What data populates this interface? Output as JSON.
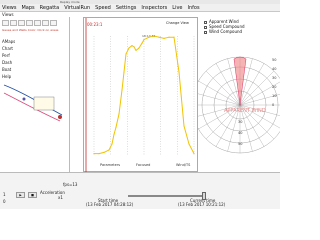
{
  "window": {
    "title": "Weather Routing Application",
    "subtitle": "Replay mode"
  },
  "menu": {
    "items": [
      "Views",
      "Maps",
      "Regatta",
      "VirtualRun",
      "Speed",
      "Settings",
      "Inspectors",
      "Live",
      "Infos"
    ]
  },
  "views_label": "Views",
  "left_panel": {
    "hint": "Issues and Wells Color: Click on areas",
    "items": [
      "AMaps",
      "Chart",
      "Perf",
      "Dash",
      "Boat",
      "Help"
    ]
  },
  "center_panel": {
    "top_label": "00:23:1",
    "top_value": "18:10.52",
    "legend": "Change View",
    "bottom_labels": {
      "left": "Parameters",
      "middle": "Focused",
      "right": "Wind/TS"
    },
    "fps_label": "fps=13"
  },
  "polar_panel": {
    "legend": [
      "Apparent Wind",
      "Speed Compound",
      "Wind Compound"
    ],
    "apparent_wind_label": "APPARENT WIND",
    "tick_labels_right": [
      "50",
      "40",
      "30",
      "20",
      "10",
      "0"
    ],
    "tick_labels_bottom": [
      "30",
      "40",
      "50"
    ]
  },
  "bottom_bar": {
    "acceleration_label": "Acceleration",
    "acceleration_value": "x1",
    "start_time_label": "Start time",
    "start_time_value": "(13 Feb 2017 04:28:12)",
    "current_time_label": "Current time",
    "current_time_value": "(13 Feb 2017 10:21:12)",
    "left_numbers": [
      "1",
      "0"
    ],
    "play_labels": [
      "▶",
      "■"
    ]
  },
  "chart_data": {
    "type": "line",
    "title": "",
    "xlabel": "",
    "ylabel": "",
    "x": [
      0,
      5,
      10,
      15,
      18,
      20,
      22,
      25,
      28,
      30,
      32,
      35,
      38,
      40,
      42,
      45,
      48,
      50,
      55,
      60,
      65,
      70,
      75,
      80,
      85,
      90,
      95,
      100
    ],
    "values": [
      2,
      2,
      3,
      5,
      10,
      18,
      24,
      35,
      55,
      70,
      85,
      90,
      92,
      91,
      88,
      90,
      94,
      97,
      99,
      100,
      99,
      98,
      99,
      99,
      70,
      25,
      10,
      2
    ],
    "ylim": [
      0,
      100
    ]
  },
  "colors": {
    "line": "#f2c200",
    "menu_bg": "#f0f0f0",
    "alert": "#c62828",
    "apparent_wind_fill": "#f08080",
    "grid": "#8c8c8c"
  }
}
